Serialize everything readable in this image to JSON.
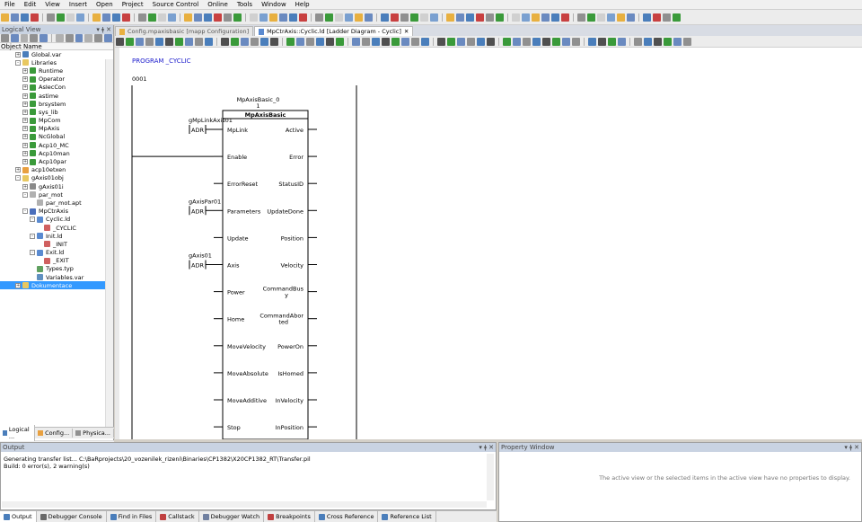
{
  "menu": [
    "File",
    "Edit",
    "View",
    "Insert",
    "Open",
    "Project",
    "Source Control",
    "Online",
    "Tools",
    "Window",
    "Help"
  ],
  "logical_view": {
    "title": "Logical View",
    "column_header": "Object Name",
    "tree": [
      {
        "label": "Global.var",
        "indent": 2,
        "expander": "+",
        "icon_color": "#4a7ebb"
      },
      {
        "label": "Libraries",
        "indent": 2,
        "expander": "-",
        "icon_color": "#e8c860"
      },
      {
        "label": "Runtime",
        "indent": 3,
        "expander": "+",
        "icon_color": "#3a9a3a"
      },
      {
        "label": "Operator",
        "indent": 3,
        "expander": "+",
        "icon_color": "#3a9a3a"
      },
      {
        "label": "AsIecCon",
        "indent": 3,
        "expander": "+",
        "icon_color": "#3a9a3a"
      },
      {
        "label": "astime",
        "indent": 3,
        "expander": "+",
        "icon_color": "#3a9a3a"
      },
      {
        "label": "brsystem",
        "indent": 3,
        "expander": "+",
        "icon_color": "#3a9a3a"
      },
      {
        "label": "sys_lib",
        "indent": 3,
        "expander": "+",
        "icon_color": "#3a9a3a"
      },
      {
        "label": "MpCom",
        "indent": 3,
        "expander": "+",
        "icon_color": "#3a9a3a"
      },
      {
        "label": "MpAxis",
        "indent": 3,
        "expander": "+",
        "icon_color": "#3a9a3a"
      },
      {
        "label": "NcGlobal",
        "indent": 3,
        "expander": "+",
        "icon_color": "#3a9a3a"
      },
      {
        "label": "Acp10_MC",
        "indent": 3,
        "expander": "+",
        "icon_color": "#3a9a3a"
      },
      {
        "label": "Acp10man",
        "indent": 3,
        "expander": "+",
        "icon_color": "#3a9a3a"
      },
      {
        "label": "Acp10par",
        "indent": 3,
        "expander": "+",
        "icon_color": "#3a9a3a"
      },
      {
        "label": "acp10etxen",
        "indent": 2,
        "expander": "+",
        "icon_color": "#e8a040"
      },
      {
        "label": "gAxis01obj",
        "indent": 2,
        "expander": "-",
        "icon_color": "#e8c860"
      },
      {
        "label": "gAxis01i",
        "indent": 3,
        "expander": "+",
        "icon_color": "#8a8a8a"
      },
      {
        "label": "par_mot",
        "indent": 3,
        "expander": "-",
        "icon_color": "#b0b0b0"
      },
      {
        "label": "par_mot.apt",
        "indent": 4,
        "expander": "",
        "icon_color": "#b0b0b0"
      },
      {
        "label": "MpCtrAxis",
        "indent": 3,
        "expander": "-",
        "icon_color": "#4a6ebb"
      },
      {
        "label": "Cyclic.ld",
        "indent": 4,
        "expander": "-",
        "icon_color": "#5a8ad0"
      },
      {
        "label": "_CYCLIC",
        "indent": 5,
        "expander": "",
        "icon_color": "#d06060"
      },
      {
        "label": "Init.ld",
        "indent": 4,
        "expander": "-",
        "icon_color": "#5a8ad0"
      },
      {
        "label": "_INIT",
        "indent": 5,
        "expander": "",
        "icon_color": "#d06060"
      },
      {
        "label": "Exit.ld",
        "indent": 4,
        "expander": "-",
        "icon_color": "#5a8ad0"
      },
      {
        "label": "_EXIT",
        "indent": 5,
        "expander": "",
        "icon_color": "#d06060"
      },
      {
        "label": "Types.typ",
        "indent": 4,
        "expander": "",
        "icon_color": "#60a060"
      },
      {
        "label": "Variables.var",
        "indent": 4,
        "expander": "",
        "icon_color": "#6090c0"
      },
      {
        "label": "Dokumentace",
        "indent": 2,
        "expander": "+",
        "icon_color": "#e8c860",
        "selected": true
      }
    ],
    "bottom_tabs": [
      "Logical ...",
      "Config...",
      "Physica..."
    ]
  },
  "editor_tabs": [
    {
      "label": "Config.mpaxisbasic [mapp Configuration]",
      "active": false
    },
    {
      "label": "MpCtrAxis::Cyclic.ld [Ladder Diagram - Cyclic]",
      "active": true
    }
  ],
  "ladder": {
    "program_label": "PROGRAM _CYCLIC",
    "network_number": "0001",
    "fb_instance_line1": "MpAxisBasic_0",
    "fb_instance_line2": "1",
    "fb_type": "MpAxisBasic",
    "adr_label": "ADR",
    "input_vars": {
      "MpLink": "gMpLinkAxis01",
      "Parameters": "gAxisPar01",
      "Axis": "gAxis01"
    },
    "inputs": [
      "MpLink",
      "Enable",
      "ErrorReset",
      "Parameters",
      "Update",
      "Axis",
      "Power",
      "Home",
      "MoveVelocity",
      "MoveAbsolute",
      "MoveAdditive",
      "Stop"
    ],
    "outputs": [
      "Active",
      "Error",
      "StatusID",
      "UpdateDone",
      "Position",
      "Velocity",
      "CommandBusy",
      "CommandAborted",
      "PowerOn",
      "IsHomed",
      "InVelocity",
      "InPosition"
    ],
    "outputs_wrapped": [
      "Active",
      "Error",
      "StatusID",
      "UpdateDone",
      "Position",
      "Velocity",
      "CommandBus\ny",
      "CommandAbor\nted",
      "PowerOn",
      "IsHomed",
      "InVelocity",
      "InPosition"
    ]
  },
  "output": {
    "title": "Output",
    "lines": [
      "Generating transfer list... C:\\BaRprojects\\20_vozenilek_rizeni\\Binaries\\CP1382\\X20CP1382_RT\\Transfer.pil",
      "Build: 0 error(s), 2 warning(s)"
    ],
    "tabs": [
      {
        "label": "Output",
        "active": true,
        "color": "#4a7ebb"
      },
      {
        "label": "Debugger Console",
        "active": false,
        "color": "#6a6a6a"
      },
      {
        "label": "Find in Files",
        "active": false,
        "color": "#4a7ebb"
      },
      {
        "label": "Callstack",
        "active": false,
        "color": "#c04040"
      },
      {
        "label": "Debugger Watch",
        "active": false,
        "color": "#7080a0"
      },
      {
        "label": "Breakpoints",
        "active": false,
        "color": "#c04040"
      },
      {
        "label": "Cross Reference",
        "active": false,
        "color": "#4a7ebb"
      },
      {
        "label": "Reference List",
        "active": false,
        "color": "#4a7ebb"
      }
    ]
  },
  "property_window": {
    "title": "Property Window",
    "message": "The active view or the selected items in the active view have no properties to display."
  }
}
